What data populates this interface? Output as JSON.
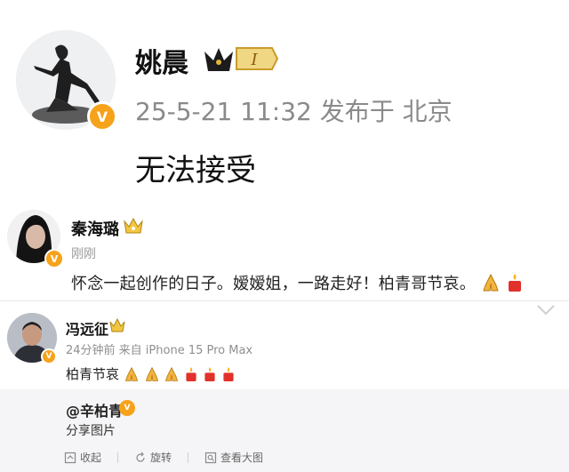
{
  "post": {
    "author": "姚晨",
    "level_badge": "I",
    "meta": "25-5-21 11:32 发布于 北京",
    "content": "无法接受",
    "verified_badge": "V"
  },
  "comments": [
    {
      "author": "秦海璐",
      "time": "刚刚",
      "text": "怀念一起创作的日子。嫒嫒姐，一路走好！柏青哥节哀。",
      "verified_badge": "V"
    },
    {
      "author": "冯远征",
      "meta": "24分钟前 来自 iPhone 15 Pro Max",
      "text": "柏青节哀",
      "verified_badge": "V"
    }
  ],
  "quote": {
    "user": "@辛柏青",
    "text": "分享图片",
    "verified_badge": "V",
    "actions": [
      "收起",
      "旋转",
      "查看大图"
    ]
  },
  "colors": {
    "accent_verify": "#f7a21b",
    "crown_gold": "#d7a52a",
    "quote_bg": "#f5f5f7"
  },
  "icons": [
    "crown-icon",
    "verified-icon",
    "pray-emoji",
    "candle-emoji",
    "chevron-down-icon",
    "collapse-icon",
    "rotate-icon",
    "zoom-icon"
  ]
}
